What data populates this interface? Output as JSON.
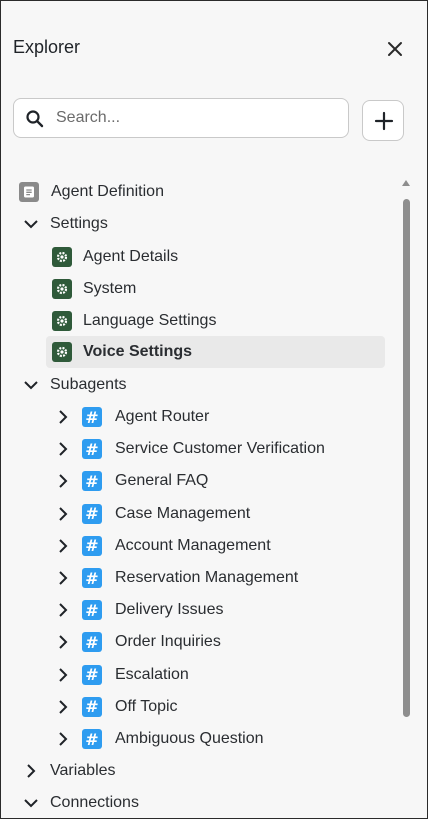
{
  "panel": {
    "title": "Explorer",
    "close_icon": "close-icon",
    "search": {
      "placeholder": "Search...",
      "value": ""
    },
    "add_icon": "plus-icon"
  },
  "tree": {
    "agent_definition": {
      "label": "Agent Definition",
      "icon": "document-icon"
    },
    "settings": {
      "label": "Settings",
      "expanded": true,
      "items": [
        {
          "label": "Agent Details"
        },
        {
          "label": "System"
        },
        {
          "label": "Language Settings"
        },
        {
          "label": "Voice Settings",
          "selected": true
        }
      ]
    },
    "subagents": {
      "label": "Subagents",
      "expanded": true,
      "items": [
        {
          "label": "Agent Router"
        },
        {
          "label": "Service Customer Verification"
        },
        {
          "label": "General FAQ"
        },
        {
          "label": "Case Management"
        },
        {
          "label": "Account Management"
        },
        {
          "label": "Reservation Management"
        },
        {
          "label": "Delivery Issues"
        },
        {
          "label": "Order Inquiries"
        },
        {
          "label": "Escalation"
        },
        {
          "label": "Off Topic"
        },
        {
          "label": "Ambiguous Question"
        }
      ]
    },
    "variables": {
      "label": "Variables",
      "expanded": false
    },
    "connections": {
      "label": "Connections",
      "expanded": true
    }
  },
  "colors": {
    "gear_icon_bg": "#2f5a3a",
    "hash_icon_bg": "#2e9cf0",
    "selected_row_bg": "#e9e9e9"
  }
}
